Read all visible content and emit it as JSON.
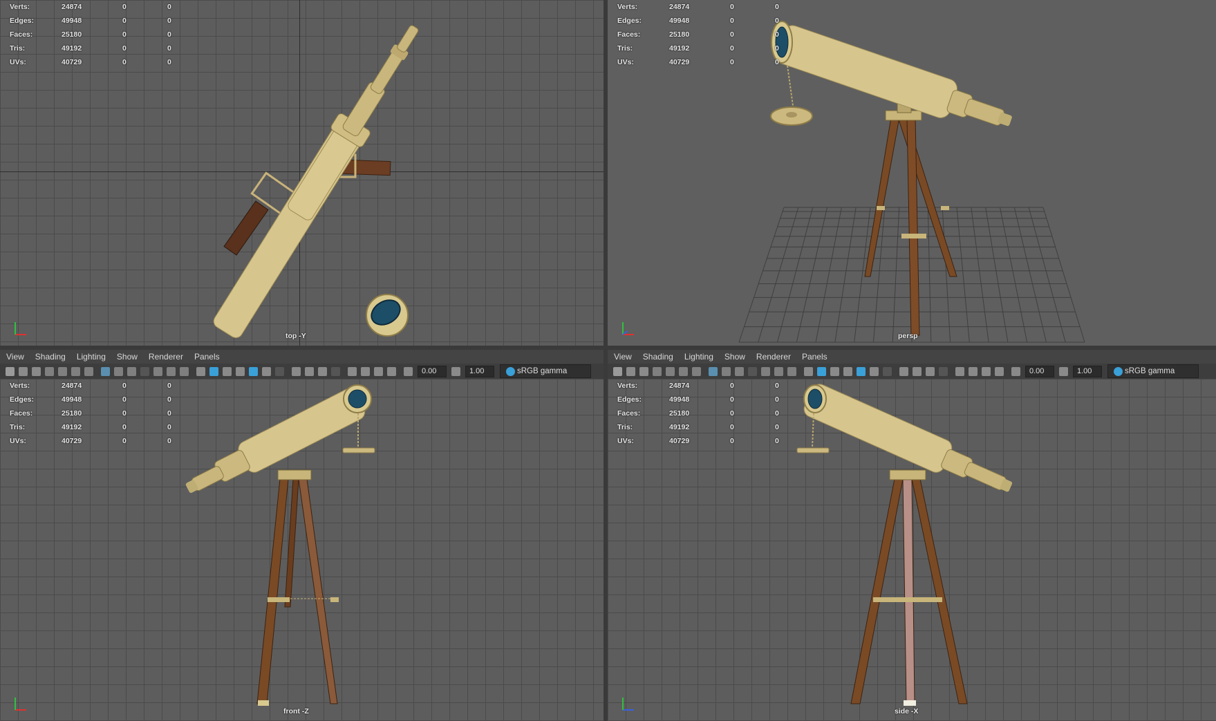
{
  "stats": {
    "rows": [
      {
        "label": "Verts:",
        "v1": "24874",
        "v2": "0",
        "v3": "0"
      },
      {
        "label": "Edges:",
        "v1": "49948",
        "v2": "0",
        "v3": "0"
      },
      {
        "label": "Faces:",
        "v1": "25180",
        "v2": "0",
        "v3": "0"
      },
      {
        "label": "Tris:",
        "v1": "49192",
        "v2": "0",
        "v3": "0"
      },
      {
        "label": "UVs:",
        "v1": "40729",
        "v2": "0",
        "v3": "0"
      }
    ]
  },
  "viewports": {
    "top_left": {
      "camera": "top -Y"
    },
    "top_right": {
      "camera": "persp"
    },
    "bottom_left": {
      "camera": "front -Z"
    },
    "bottom_right": {
      "camera": "side -X"
    }
  },
  "menu": {
    "items": [
      "View",
      "Shading",
      "Lighting",
      "Show",
      "Renderer",
      "Panels"
    ]
  },
  "toolbar": {
    "exposure": "0.00",
    "gamma_value": "1.00",
    "color_space": "sRGB gamma"
  },
  "colors": {
    "viewport_bg": "#5d5d5d",
    "grid_line": "#4b4b4b",
    "brass": "#d8c98f",
    "wood": "#7a4a25",
    "highlight_blue": "#3aa0d8"
  }
}
